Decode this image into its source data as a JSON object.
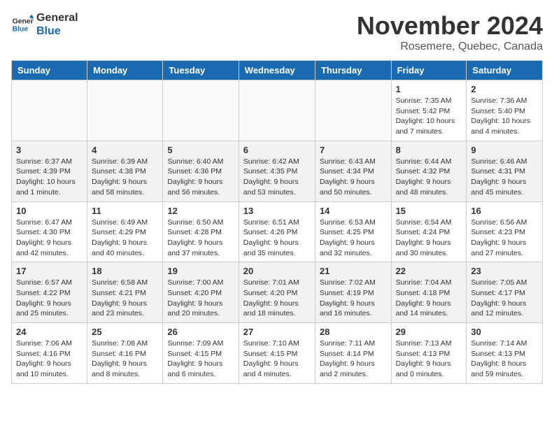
{
  "logo": {
    "line1": "General",
    "line2": "Blue"
  },
  "title": "November 2024",
  "location": "Rosemere, Quebec, Canada",
  "days_of_week": [
    "Sunday",
    "Monday",
    "Tuesday",
    "Wednesday",
    "Thursday",
    "Friday",
    "Saturday"
  ],
  "weeks": [
    [
      {
        "num": "",
        "info": ""
      },
      {
        "num": "",
        "info": ""
      },
      {
        "num": "",
        "info": ""
      },
      {
        "num": "",
        "info": ""
      },
      {
        "num": "",
        "info": ""
      },
      {
        "num": "1",
        "info": "Sunrise: 7:35 AM\nSunset: 5:42 PM\nDaylight: 10 hours and 7 minutes."
      },
      {
        "num": "2",
        "info": "Sunrise: 7:36 AM\nSunset: 5:40 PM\nDaylight: 10 hours and 4 minutes."
      }
    ],
    [
      {
        "num": "3",
        "info": "Sunrise: 6:37 AM\nSunset: 4:39 PM\nDaylight: 10 hours and 1 minute."
      },
      {
        "num": "4",
        "info": "Sunrise: 6:39 AM\nSunset: 4:38 PM\nDaylight: 9 hours and 58 minutes."
      },
      {
        "num": "5",
        "info": "Sunrise: 6:40 AM\nSunset: 4:36 PM\nDaylight: 9 hours and 56 minutes."
      },
      {
        "num": "6",
        "info": "Sunrise: 6:42 AM\nSunset: 4:35 PM\nDaylight: 9 hours and 53 minutes."
      },
      {
        "num": "7",
        "info": "Sunrise: 6:43 AM\nSunset: 4:34 PM\nDaylight: 9 hours and 50 minutes."
      },
      {
        "num": "8",
        "info": "Sunrise: 6:44 AM\nSunset: 4:32 PM\nDaylight: 9 hours and 48 minutes."
      },
      {
        "num": "9",
        "info": "Sunrise: 6:46 AM\nSunset: 4:31 PM\nDaylight: 9 hours and 45 minutes."
      }
    ],
    [
      {
        "num": "10",
        "info": "Sunrise: 6:47 AM\nSunset: 4:30 PM\nDaylight: 9 hours and 42 minutes."
      },
      {
        "num": "11",
        "info": "Sunrise: 6:49 AM\nSunset: 4:29 PM\nDaylight: 9 hours and 40 minutes."
      },
      {
        "num": "12",
        "info": "Sunrise: 6:50 AM\nSunset: 4:28 PM\nDaylight: 9 hours and 37 minutes."
      },
      {
        "num": "13",
        "info": "Sunrise: 6:51 AM\nSunset: 4:26 PM\nDaylight: 9 hours and 35 minutes."
      },
      {
        "num": "14",
        "info": "Sunrise: 6:53 AM\nSunset: 4:25 PM\nDaylight: 9 hours and 32 minutes."
      },
      {
        "num": "15",
        "info": "Sunrise: 6:54 AM\nSunset: 4:24 PM\nDaylight: 9 hours and 30 minutes."
      },
      {
        "num": "16",
        "info": "Sunrise: 6:56 AM\nSunset: 4:23 PM\nDaylight: 9 hours and 27 minutes."
      }
    ],
    [
      {
        "num": "17",
        "info": "Sunrise: 6:57 AM\nSunset: 4:22 PM\nDaylight: 9 hours and 25 minutes."
      },
      {
        "num": "18",
        "info": "Sunrise: 6:58 AM\nSunset: 4:21 PM\nDaylight: 9 hours and 23 minutes."
      },
      {
        "num": "19",
        "info": "Sunrise: 7:00 AM\nSunset: 4:20 PM\nDaylight: 9 hours and 20 minutes."
      },
      {
        "num": "20",
        "info": "Sunrise: 7:01 AM\nSunset: 4:20 PM\nDaylight: 9 hours and 18 minutes."
      },
      {
        "num": "21",
        "info": "Sunrise: 7:02 AM\nSunset: 4:19 PM\nDaylight: 9 hours and 16 minutes."
      },
      {
        "num": "22",
        "info": "Sunrise: 7:04 AM\nSunset: 4:18 PM\nDaylight: 9 hours and 14 minutes."
      },
      {
        "num": "23",
        "info": "Sunrise: 7:05 AM\nSunset: 4:17 PM\nDaylight: 9 hours and 12 minutes."
      }
    ],
    [
      {
        "num": "24",
        "info": "Sunrise: 7:06 AM\nSunset: 4:16 PM\nDaylight: 9 hours and 10 minutes."
      },
      {
        "num": "25",
        "info": "Sunrise: 7:08 AM\nSunset: 4:16 PM\nDaylight: 9 hours and 8 minutes."
      },
      {
        "num": "26",
        "info": "Sunrise: 7:09 AM\nSunset: 4:15 PM\nDaylight: 9 hours and 6 minutes."
      },
      {
        "num": "27",
        "info": "Sunrise: 7:10 AM\nSunset: 4:15 PM\nDaylight: 9 hours and 4 minutes."
      },
      {
        "num": "28",
        "info": "Sunrise: 7:11 AM\nSunset: 4:14 PM\nDaylight: 9 hours and 2 minutes."
      },
      {
        "num": "29",
        "info": "Sunrise: 7:13 AM\nSunset: 4:13 PM\nDaylight: 9 hours and 0 minutes."
      },
      {
        "num": "30",
        "info": "Sunrise: 7:14 AM\nSunset: 4:13 PM\nDaylight: 8 hours and 59 minutes."
      }
    ]
  ]
}
